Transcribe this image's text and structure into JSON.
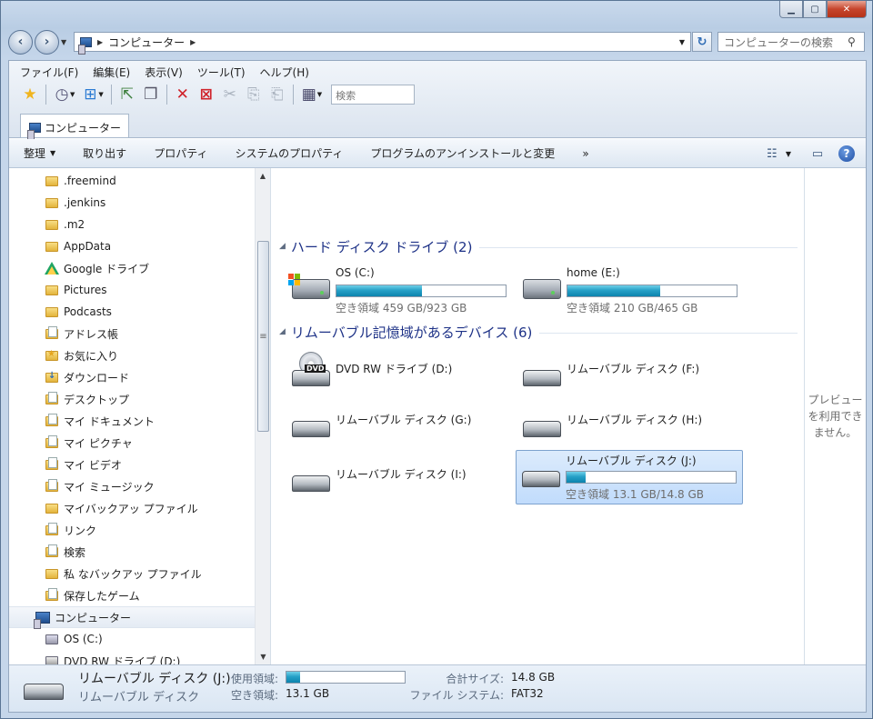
{
  "window": {
    "caption_min": "▁",
    "caption_max": "▢",
    "caption_close": "✕"
  },
  "address": {
    "path": "コンピューター",
    "search_placeholder": "コンピューターの検索"
  },
  "menubar": [
    "ファイル(F)",
    "編集(E)",
    "表示(V)",
    "ツール(T)",
    "ヘルプ(H)"
  ],
  "toolbar": {
    "search_placeholder": "検索"
  },
  "tab": {
    "label": "コンピューター"
  },
  "commandbar": {
    "items": [
      "整理",
      "取り出す",
      "プロパティ",
      "システムのプロパティ",
      "プログラムのアンインストールと変更"
    ],
    "more": "»"
  },
  "nav_tree": {
    "items": [
      {
        "label": ".freemind",
        "icon": "folder-icon"
      },
      {
        "label": ".jenkins",
        "icon": "folder-icon"
      },
      {
        "label": ".m2",
        "icon": "folder-icon"
      },
      {
        "label": "AppData",
        "icon": "folder-icon"
      },
      {
        "label": "Google ドライブ",
        "icon": "google-drive-icon"
      },
      {
        "label": "Pictures",
        "icon": "folder-icon"
      },
      {
        "label": "Podcasts",
        "icon": "folder-icon"
      },
      {
        "label": "アドレス帳",
        "icon": "contacts-folder-icon"
      },
      {
        "label": "お気に入り",
        "icon": "favorites-folder-icon"
      },
      {
        "label": "ダウンロード",
        "icon": "downloads-folder-icon"
      },
      {
        "label": "デスクトップ",
        "icon": "desktop-folder-icon"
      },
      {
        "label": "マイ ドキュメント",
        "icon": "documents-folder-icon"
      },
      {
        "label": "マイ ピクチャ",
        "icon": "pictures-folder-icon"
      },
      {
        "label": "マイ ビデオ",
        "icon": "videos-folder-icon"
      },
      {
        "label": "マイ ミュージック",
        "icon": "music-folder-icon"
      },
      {
        "label": "マイバックアッ プファイル",
        "icon": "folder-icon"
      },
      {
        "label": "リンク",
        "icon": "links-folder-icon"
      },
      {
        "label": "検索",
        "icon": "searches-folder-icon"
      },
      {
        "label": "私 なバックアッ プファイル",
        "icon": "folder-icon"
      },
      {
        "label": "保存したゲーム",
        "icon": "saved-games-folder-icon"
      }
    ],
    "computer": "コンピューター",
    "children": [
      {
        "label": "OS (C:)",
        "icon": "os-drive-icon"
      },
      {
        "label": "DVD RW ドライブ (D:)",
        "icon": "dvd-drive-icon"
      }
    ]
  },
  "groups": {
    "hard_disks": "ハード ディスク ドライブ (2)",
    "removable": "リムーバブル記憶域があるデバイス (6)"
  },
  "drives": {
    "c": {
      "name": "OS (C:)",
      "free": "空き領域 459 GB/923 GB",
      "used_fraction": 0.503
    },
    "e": {
      "name": "home (E:)",
      "free": "空き領域 210 GB/465 GB",
      "used_fraction": 0.548
    },
    "d": {
      "name": "DVD RW ドライブ (D:)"
    },
    "f": {
      "name": "リムーバブル ディスク (F:)"
    },
    "g": {
      "name": "リムーバブル ディスク (G:)"
    },
    "h": {
      "name": "リムーバブル ディスク (H:)"
    },
    "i": {
      "name": "リムーバブル ディスク (I:)"
    },
    "j": {
      "name": "リムーバブル ディスク (J:)",
      "free": "空き領域 13.1 GB/14.8 GB",
      "used_fraction": 0.115
    }
  },
  "preview": {
    "message": "プレビューを利用できません。"
  },
  "details": {
    "title": "リムーバブル ディスク (J:)",
    "subtitle": "リムーバブル ディスク",
    "used_label": "使用領域:",
    "free_label": "空き領域:",
    "free_value": "13.1 GB",
    "total_label": "合計サイズ:",
    "total_value": "14.8 GB",
    "fs_label": "ファイル システム:",
    "fs_value": "FAT32",
    "used_fraction": 0.115
  },
  "colors": {
    "accent": "#1e3287",
    "bar_fill": "#26a0c7",
    "selection": "#c1dcfc"
  }
}
